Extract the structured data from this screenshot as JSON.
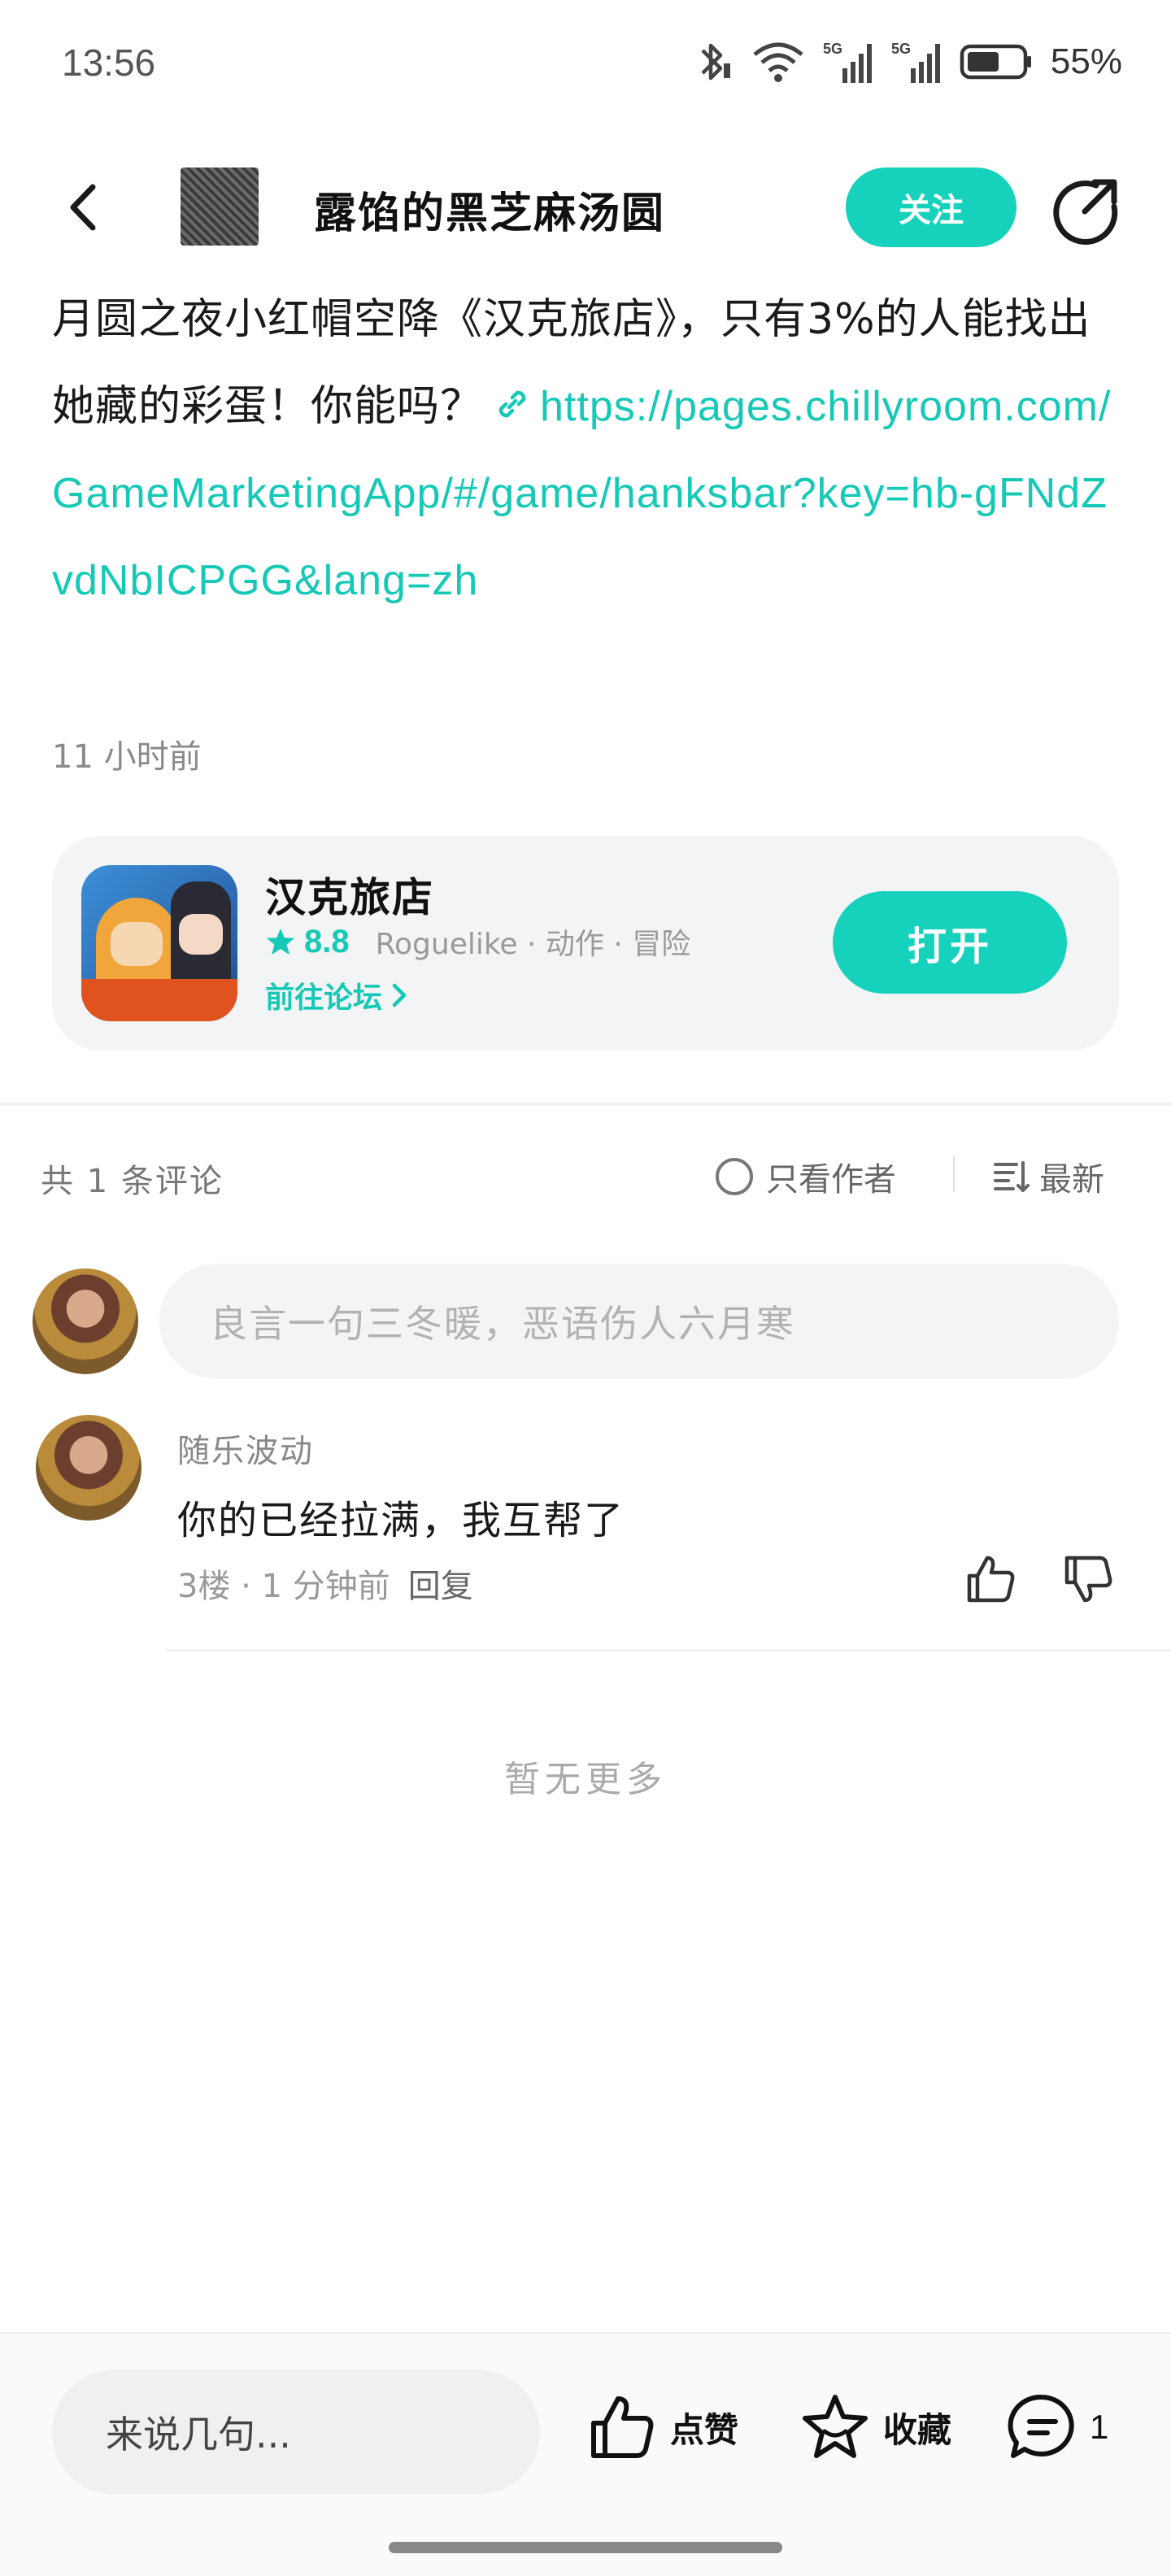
{
  "status_bar": {
    "time": "13:56",
    "icons": [
      "bluetooth-icon",
      "wifi-icon",
      "signal-5g-icon",
      "signal-5g-icon",
      "battery-icon"
    ],
    "network_label_1": "5G",
    "network_label_2": "5G",
    "battery_percent": "55%"
  },
  "header": {
    "title": "露馅的黑芝麻汤圆",
    "follow_label": "关注"
  },
  "post": {
    "text": "月圆之夜小红帽空降《汉克旅店》，只有3%的人能找出她藏的彩蛋！你能吗？",
    "link": "https://pages.chillyroom.com/GameMarketingApp/#/game/hanksbar?key=hb-gFNdZvdNbICPGG&lang=zh",
    "time": "11 小时前"
  },
  "game_card": {
    "name": "汉克旅店",
    "rating": "8.8",
    "tags": "Roguelike · 动作 · 冒险",
    "forum_link": "前往论坛",
    "open_label": "打开"
  },
  "comments_section": {
    "count_label": "共 1 条评论",
    "author_only_label": "只看作者",
    "sort_label": "最新",
    "input_placeholder": "良言一句三冬暖，恶语伤人六月寒"
  },
  "comments": [
    {
      "author": "随乐波动",
      "text": "你的已经拉满，我互帮了",
      "floor": "3楼 · 1 分钟前",
      "reply_label": "回复"
    }
  ],
  "no_more_label": "暂无更多",
  "bottom_bar": {
    "input_placeholder": "来说几句...",
    "like_label": "点赞",
    "favorite_label": "收藏",
    "comment_count": "1"
  },
  "colors": {
    "accent": "#16d2bd",
    "link": "#16c9b6",
    "text_primary": "#1a1a1a",
    "text_secondary": "#8a8a8a",
    "card_bg": "#f2f4f5"
  }
}
